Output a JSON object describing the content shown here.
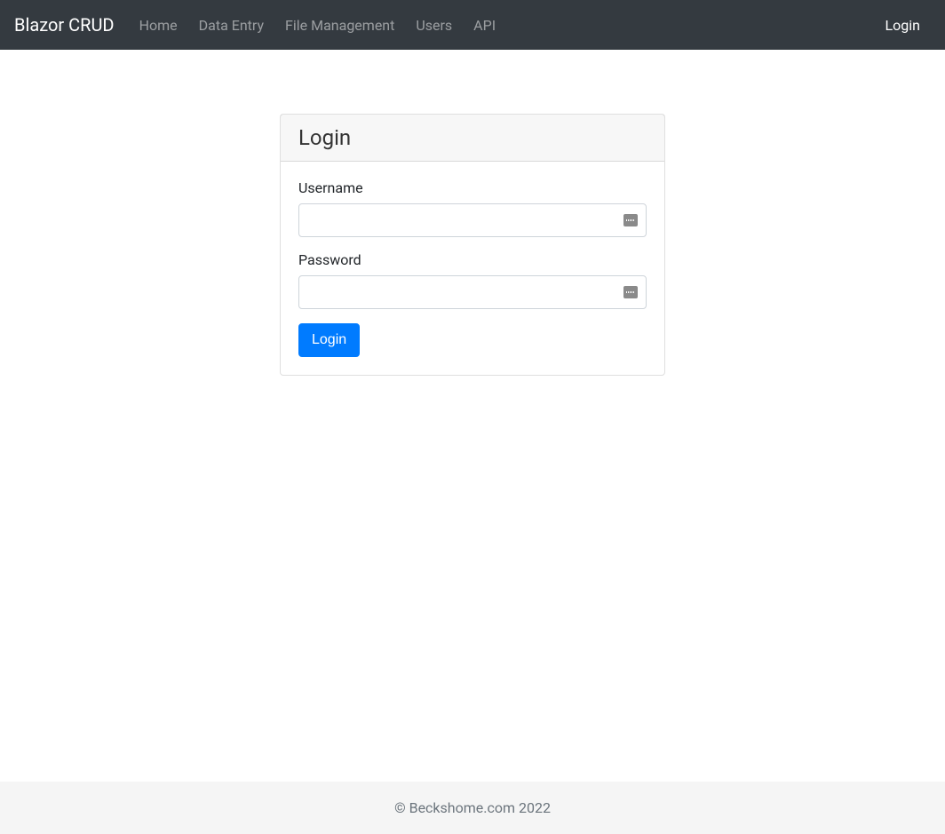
{
  "navbar": {
    "brand": "Blazor CRUD",
    "links": [
      {
        "label": "Home"
      },
      {
        "label": "Data Entry"
      },
      {
        "label": "File Management"
      },
      {
        "label": "Users"
      },
      {
        "label": "API"
      }
    ],
    "right_link": "Login"
  },
  "login_card": {
    "title": "Login",
    "username_label": "Username",
    "username_value": "",
    "password_label": "Password",
    "password_value": "",
    "submit_label": "Login"
  },
  "footer": {
    "text": "© Beckshome.com 2022"
  }
}
